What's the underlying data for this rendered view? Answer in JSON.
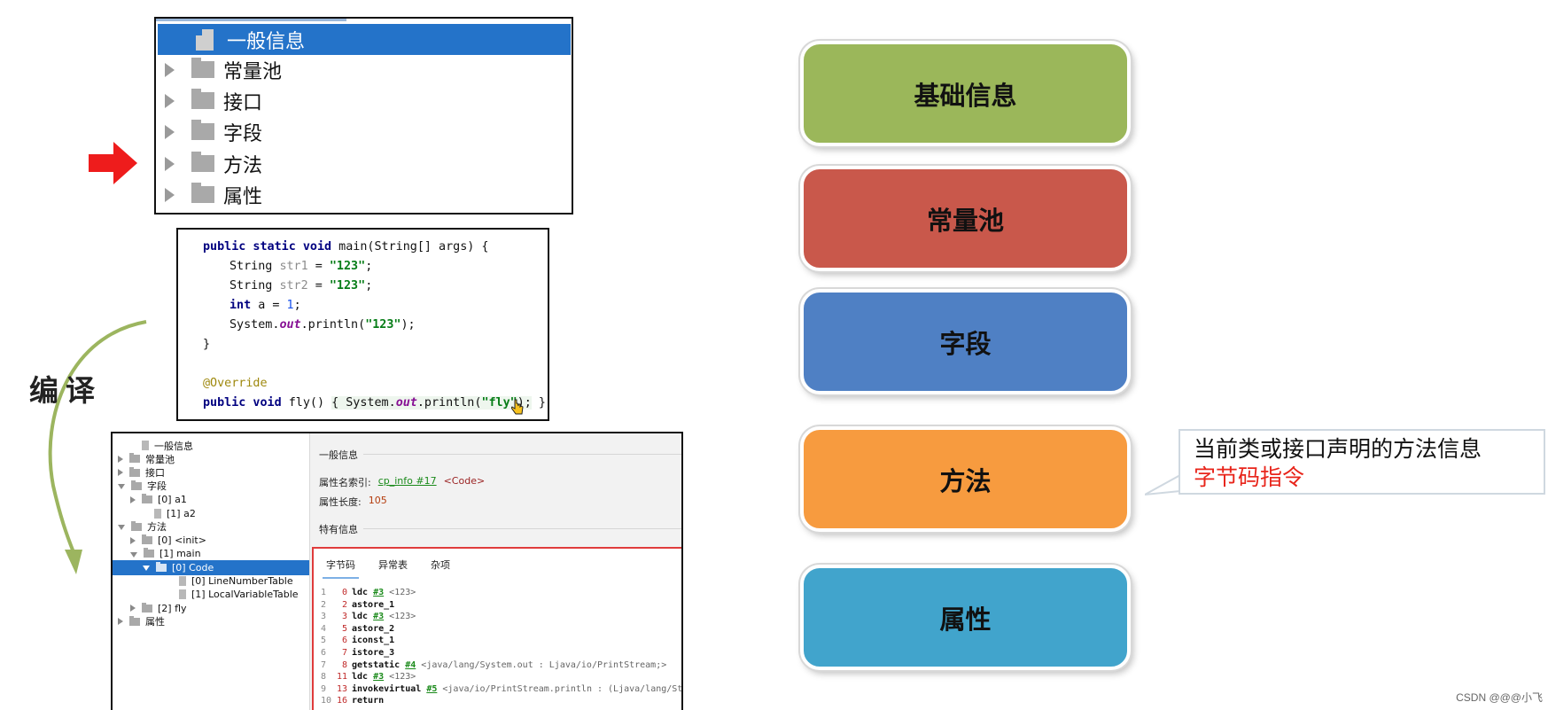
{
  "tree_top": {
    "items": [
      {
        "label": "一般信息",
        "selected": true,
        "icon": "document-icon"
      },
      {
        "label": "常量池",
        "icon": "folder-icon"
      },
      {
        "label": "接口",
        "icon": "folder-icon"
      },
      {
        "label": "字段",
        "icon": "folder-icon"
      },
      {
        "label": "方法",
        "icon": "folder-icon"
      },
      {
        "label": "属性",
        "icon": "folder-icon"
      }
    ]
  },
  "code": {
    "lines": [
      [
        "public static void",
        " main(String[] args) {"
      ],
      [
        "String ",
        "str1",
        " = ",
        "\"123\"",
        ";"
      ],
      [
        "String ",
        "str2",
        " = ",
        "\"123\"",
        ";"
      ],
      [
        "int",
        " a = ",
        "1",
        ";"
      ],
      [
        "System.",
        "out",
        ".println(",
        "\"123\"",
        ");"
      ],
      [
        "}"
      ],
      [
        "@Override"
      ],
      [
        "public void",
        " fly() ",
        "{",
        " System.",
        "out",
        ".println(",
        "\"fly\"",
        ");",
        " }"
      ]
    ]
  },
  "compile_label": "编译",
  "viewer": {
    "tree": [
      {
        "label": "一般信息",
        "icon": "doc",
        "indent": 1
      },
      {
        "label": "常量池",
        "icon": "folder",
        "indent": 0,
        "toggle": "right"
      },
      {
        "label": "接口",
        "icon": "folder",
        "indent": 0,
        "toggle": "right"
      },
      {
        "label": "字段",
        "icon": "folder",
        "indent": 0,
        "toggle": "down"
      },
      {
        "label": "[0] a1",
        "icon": "folder",
        "indent": 1,
        "toggle": "right"
      },
      {
        "label": "[1] a2",
        "icon": "doc",
        "indent": 2
      },
      {
        "label": "方法",
        "icon": "folder",
        "indent": 0,
        "toggle": "down"
      },
      {
        "label": "[0] <init>",
        "icon": "folder",
        "indent": 1,
        "toggle": "right"
      },
      {
        "label": "[1] main",
        "icon": "folder",
        "indent": 1,
        "toggle": "down"
      },
      {
        "label": "[0] Code",
        "icon": "folder",
        "indent": 2,
        "toggle": "down",
        "selected": true
      },
      {
        "label": "[0] LineNumberTable",
        "icon": "doc",
        "indent": 4
      },
      {
        "label": "[1] LocalVariableTable",
        "icon": "doc",
        "indent": 4
      },
      {
        "label": "[2] fly",
        "icon": "folder",
        "indent": 1,
        "toggle": "right"
      },
      {
        "label": "属性",
        "icon": "folder",
        "indent": 0,
        "toggle": "right"
      }
    ],
    "general_title": "一般信息",
    "attr_name_label": "属性名索引:",
    "attr_name_link": "cp_info #17",
    "attr_name_value": "<Code>",
    "attr_len_label": "属性长度:",
    "attr_len_value": "105",
    "specific_title": "特有信息",
    "tabs": [
      "字节码",
      "异常表",
      "杂项"
    ],
    "bytecode": [
      {
        "line": "1",
        "off": "0",
        "op": "ldc",
        "ref": "#3",
        "cmt": "<123>"
      },
      {
        "line": "2",
        "off": "2",
        "op": "astore_1",
        "ref": "",
        "cmt": ""
      },
      {
        "line": "3",
        "off": "3",
        "op": "ldc",
        "ref": "#3",
        "cmt": "<123>"
      },
      {
        "line": "4",
        "off": "5",
        "op": "astore_2",
        "ref": "",
        "cmt": ""
      },
      {
        "line": "5",
        "off": "6",
        "op": "iconst_1",
        "ref": "",
        "cmt": ""
      },
      {
        "line": "6",
        "off": "7",
        "op": "istore_3",
        "ref": "",
        "cmt": ""
      },
      {
        "line": "7",
        "off": "8",
        "op": "getstatic",
        "ref": "#4",
        "cmt": "<java/lang/System.out : Ljava/io/PrintStream;>"
      },
      {
        "line": "8",
        "off": "11",
        "op": "ldc",
        "ref": "#3",
        "cmt": "<123>"
      },
      {
        "line": "9",
        "off": "13",
        "op": "invokevirtual",
        "ref": "#5",
        "cmt": "<java/io/PrintStream.println : (Ljava/lang/String;)V>"
      },
      {
        "line": "10",
        "off": "16",
        "op": "return",
        "ref": "",
        "cmt": ""
      }
    ]
  },
  "categories": [
    {
      "label": "基础信息",
      "color": "#9bb75a"
    },
    {
      "label": "常量池",
      "color": "#c9584b"
    },
    {
      "label": "字段",
      "color": "#4f80c4"
    },
    {
      "label": "方法",
      "color": "#f79b3f"
    },
    {
      "label": "属性",
      "color": "#41a4cc"
    }
  ],
  "callout": {
    "line1": "当前类或接口声明的方法信息",
    "line2": "字节码指令"
  },
  "watermark": "CSDN @@@小飞"
}
